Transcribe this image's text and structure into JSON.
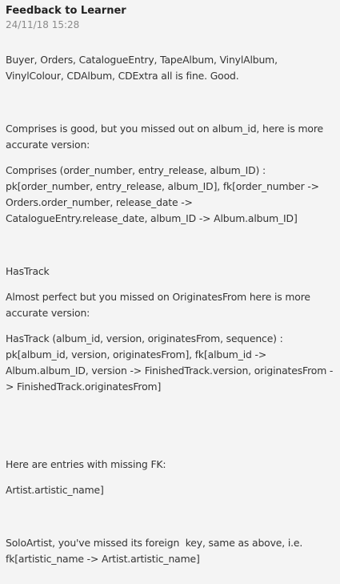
{
  "feedback": {
    "title": "Feedback to Learner",
    "timestamp": "24/11/18 15:28",
    "paragraphs": [
      "Buyer, Orders, CatalogueEntry, TapeAlbum, VinylAlbum, VinylColour, CDAlbum, CDExtra all is fine. Good.",
      "Comprises is good, but you missed out on album_id, here is more accurate version:",
      "Comprises (order_number, entry_release, album_ID) : pk[order_number, entry_release, album_ID], fk[order_number -> Orders.order_number, release_date -> CatalogueEntry.release_date, album_ID -> Album.album_ID]",
      "HasTrack",
      "Almost perfect but you missed on OriginatesFrom here is more accurate version:",
      "HasTrack (album_id, version, originatesFrom, sequence) : pk[album_id, version, originatesFrom], fk[album_id -> Album.album_ID, version -> FinishedTrack.version, originatesFrom -> FinishedTrack.originatesFrom]",
      "Here are entries with missing FK:",
      "Artist.artistic_name]",
      "SoloArtist, you've missed its foreign  key, same as above, i.e. fk[artistic_name -> Artist.artistic_name]"
    ]
  }
}
